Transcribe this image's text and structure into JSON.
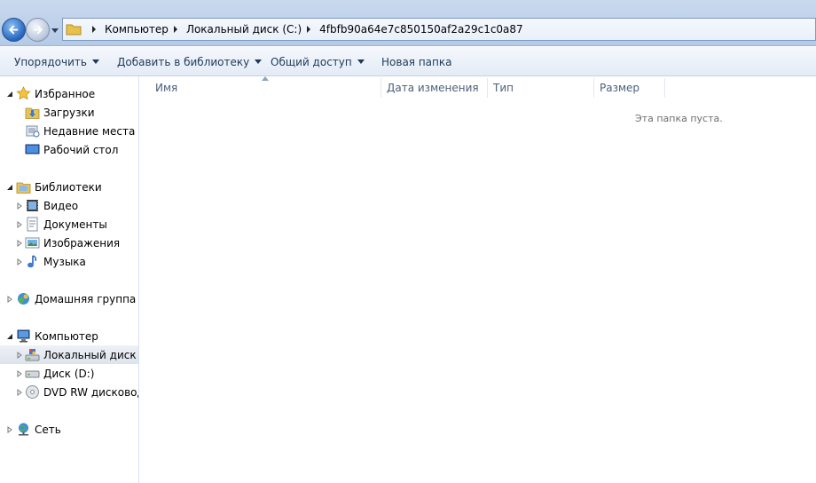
{
  "address_bar": {
    "breadcrumbs": [
      "Компьютер",
      "Локальный диск (C:)",
      "4fbfb90a64e7c850150af2a29c1c0a87"
    ]
  },
  "toolbar": {
    "organize": "Упорядочить",
    "add_to_library": "Добавить в библиотеку",
    "share": "Общий доступ",
    "new_folder": "Новая папка"
  },
  "nav": {
    "favorites": {
      "label": "Избранное",
      "items": [
        "Загрузки",
        "Недавние места",
        "Рабочий стол"
      ]
    },
    "libraries": {
      "label": "Библиотеки",
      "items": [
        "Видео",
        "Документы",
        "Изображения",
        "Музыка"
      ]
    },
    "homegroup": {
      "label": "Домашняя группа"
    },
    "computer": {
      "label": "Компьютер",
      "items": [
        "Локальный диск (C",
        "Диск  (D:)",
        "DVD RW дисковод ("
      ]
    },
    "network": {
      "label": "Сеть"
    }
  },
  "columns": [
    "Имя",
    "Дата изменения",
    "Тип",
    "Размер"
  ],
  "empty_message": "Эта папка пуста.",
  "colors": {
    "topbar": "#c9d9ee",
    "selection": "#dde3ec",
    "toolbar_text": "#1e3959",
    "header_text": "#4c607a"
  }
}
